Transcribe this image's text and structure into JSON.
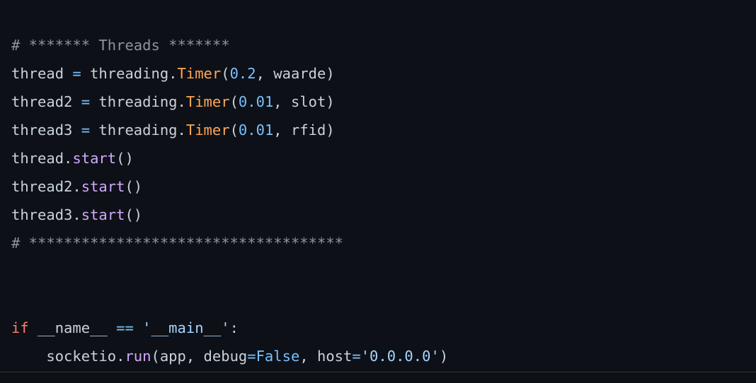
{
  "editor": {
    "background_color": "#0d1117",
    "default_text_color": "#c9d1d9",
    "language": "python",
    "rule_color": "#30363d"
  },
  "palette": {
    "comment": "#8b949e",
    "keyword": "#ff7b72",
    "function": "#d2a8ff",
    "class": "#ffa657",
    "number": "#79c0ff",
    "constant": "#79c0ff",
    "operator": "#79c0ff",
    "string": "#a5d6ff",
    "plain": "#c9d1d9"
  },
  "code": {
    "lines": [
      {
        "id": "line-comment-threads",
        "text": "# ******* Threads *******",
        "tokens": [
          {
            "kind": "comment",
            "text": "# ******* Threads *******"
          }
        ]
      },
      {
        "id": "line-thread-assign",
        "text": "thread = threading.Timer(0.2, waarde)",
        "tokens": [
          {
            "kind": "plain",
            "text": "thread "
          },
          {
            "kind": "operator",
            "text": "="
          },
          {
            "kind": "plain",
            "text": " threading."
          },
          {
            "kind": "class",
            "text": "Timer"
          },
          {
            "kind": "plain",
            "text": "("
          },
          {
            "kind": "number",
            "text": "0.2"
          },
          {
            "kind": "plain",
            "text": ", waarde)"
          }
        ]
      },
      {
        "id": "line-thread2-assign",
        "text": "thread2 = threading.Timer(0.01, slot)",
        "tokens": [
          {
            "kind": "plain",
            "text": "thread2 "
          },
          {
            "kind": "operator",
            "text": "="
          },
          {
            "kind": "plain",
            "text": " threading."
          },
          {
            "kind": "class",
            "text": "Timer"
          },
          {
            "kind": "plain",
            "text": "("
          },
          {
            "kind": "number",
            "text": "0.01"
          },
          {
            "kind": "plain",
            "text": ", slot)"
          }
        ]
      },
      {
        "id": "line-thread3-assign",
        "text": "thread3 = threading.Timer(0.01, rfid)",
        "tokens": [
          {
            "kind": "plain",
            "text": "thread3 "
          },
          {
            "kind": "operator",
            "text": "="
          },
          {
            "kind": "plain",
            "text": " threading."
          },
          {
            "kind": "class",
            "text": "Timer"
          },
          {
            "kind": "plain",
            "text": "("
          },
          {
            "kind": "number",
            "text": "0.01"
          },
          {
            "kind": "plain",
            "text": ", rfid)"
          }
        ]
      },
      {
        "id": "line-thread-start",
        "text": "thread.start()",
        "tokens": [
          {
            "kind": "plain",
            "text": "thread."
          },
          {
            "kind": "function",
            "text": "start"
          },
          {
            "kind": "plain",
            "text": "()"
          }
        ]
      },
      {
        "id": "line-thread2-start",
        "text": "thread2.start()",
        "tokens": [
          {
            "kind": "plain",
            "text": "thread2."
          },
          {
            "kind": "function",
            "text": "start"
          },
          {
            "kind": "plain",
            "text": "()"
          }
        ]
      },
      {
        "id": "line-thread3-start",
        "text": "thread3.start()",
        "tokens": [
          {
            "kind": "plain",
            "text": "thread3."
          },
          {
            "kind": "function",
            "text": "start"
          },
          {
            "kind": "plain",
            "text": "()"
          }
        ]
      },
      {
        "id": "line-comment-separator",
        "text": "# ************************************",
        "tokens": [
          {
            "kind": "comment",
            "text": "# ************************************"
          }
        ]
      },
      {
        "id": "line-blank-1",
        "text": "",
        "tokens": []
      },
      {
        "id": "line-blank-2",
        "text": "",
        "tokens": []
      },
      {
        "id": "line-if-main",
        "text": "if __name__ == '__main__':",
        "tokens": [
          {
            "kind": "keyword",
            "text": "if"
          },
          {
            "kind": "plain",
            "text": " __name__ "
          },
          {
            "kind": "operator",
            "text": "=="
          },
          {
            "kind": "plain",
            "text": " "
          },
          {
            "kind": "string",
            "text": "'__main__'"
          },
          {
            "kind": "plain",
            "text": ":"
          }
        ]
      },
      {
        "id": "line-socketio-run",
        "text": "    socketio.run(app, debug=False, host='0.0.0.0')",
        "tokens": [
          {
            "kind": "plain",
            "text": "    socketio."
          },
          {
            "kind": "function",
            "text": "run"
          },
          {
            "kind": "plain",
            "text": "(app, debug"
          },
          {
            "kind": "operator",
            "text": "="
          },
          {
            "kind": "const",
            "text": "False"
          },
          {
            "kind": "plain",
            "text": ", host"
          },
          {
            "kind": "operator",
            "text": "="
          },
          {
            "kind": "string",
            "text": "'0.0.0.0'"
          },
          {
            "kind": "plain",
            "text": ")"
          }
        ]
      }
    ]
  }
}
